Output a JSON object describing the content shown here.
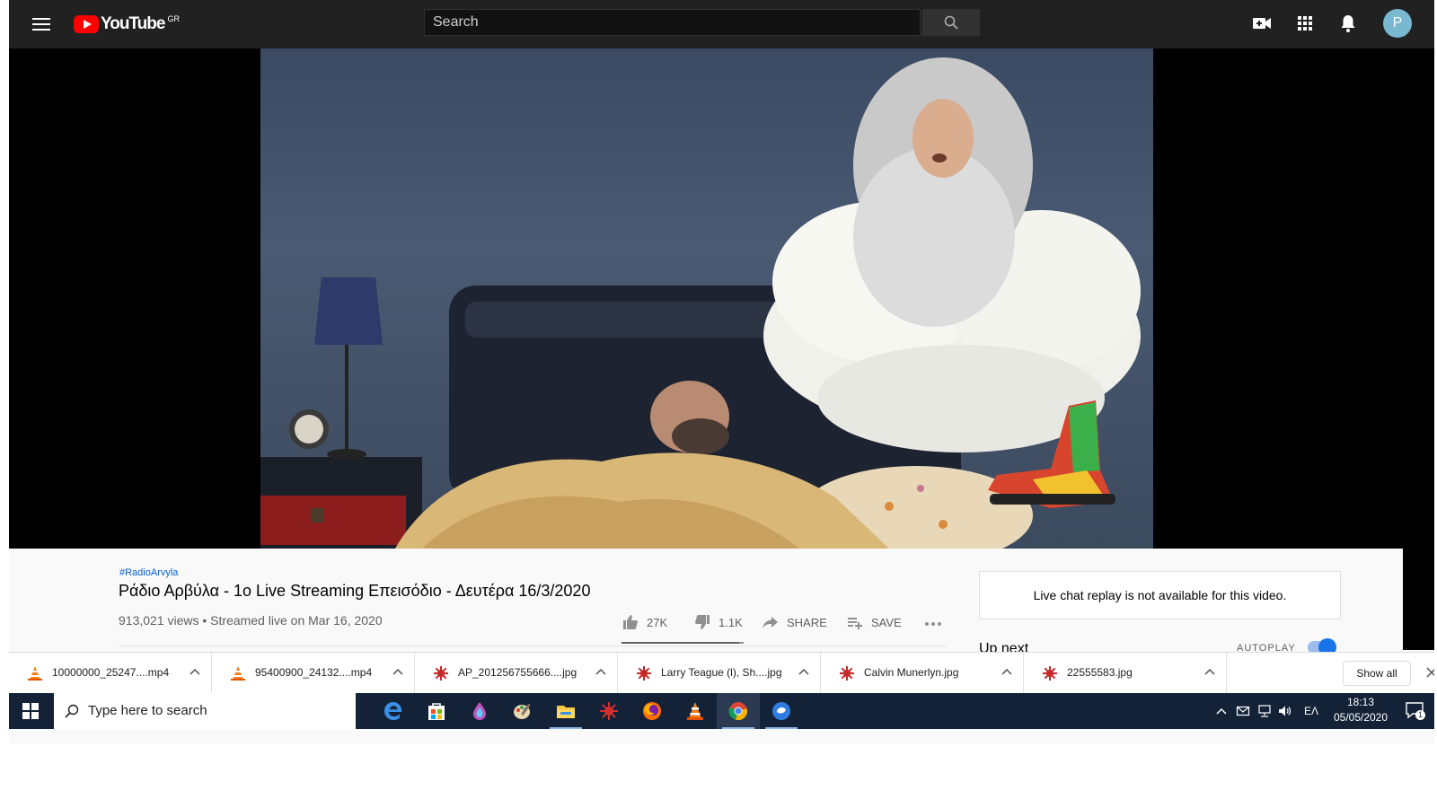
{
  "header": {
    "logo_text": "YouTube",
    "country_code": "GR",
    "search_placeholder": "Search",
    "avatar_letter": "P"
  },
  "video": {
    "hashtag": "#RadioArvyla",
    "title": "Ράδιο Αρβύλα - 1ο Live Streaming Επεισόδιο - Δευτέρα 16/3/2020",
    "meta": "913,021 views • Streamed live on Mar 16, 2020",
    "likes": "27K",
    "dislikes": "1.1K",
    "share_label": "SHARE",
    "save_label": "SAVE",
    "like_ratio": 0.96
  },
  "sidebar": {
    "chat_message": "Live chat replay is not available for this video.",
    "up_next": "Up next",
    "autoplay": "AUTOPLAY"
  },
  "downloads": {
    "items": [
      {
        "name": "10000000_25247....mp4",
        "icon": "vlc-icon"
      },
      {
        "name": "95400900_24132....mp4",
        "icon": "vlc-icon"
      },
      {
        "name": "AP_201256755666....jpg",
        "icon": "image-file-icon"
      },
      {
        "name": "Larry Teague (l), Sh....jpg",
        "icon": "image-file-icon"
      },
      {
        "name": "Calvin Munerlyn.jpg",
        "icon": "image-file-icon"
      },
      {
        "name": "22555583.jpg",
        "icon": "image-file-icon"
      }
    ],
    "show_all": "Show all"
  },
  "taskbar": {
    "search_placeholder": "Type here to search",
    "language": "ΕΛ",
    "time": "18:13",
    "date": "05/05/2020",
    "notification_count": "1",
    "apps": [
      "edge-icon",
      "store-icon",
      "paint3d-icon",
      "paint-icon",
      "file-explorer-icon",
      "app-icon",
      "firefox-icon",
      "vlc-icon",
      "chrome-icon",
      "app-icon"
    ]
  },
  "colors": {
    "youtube_red": "#ff0000",
    "header_bg": "#212121",
    "link_blue": "#065fd4",
    "taskbar_bg": "#142238"
  }
}
